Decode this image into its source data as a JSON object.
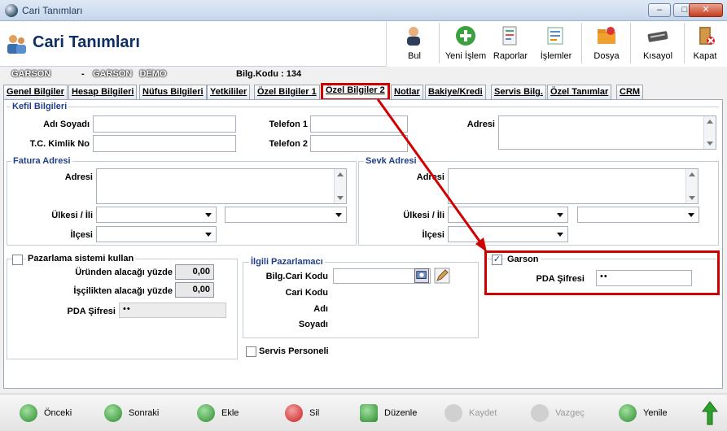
{
  "window": {
    "title": "Cari Tanımları"
  },
  "header": {
    "title": "Cari Tanımları"
  },
  "toolbar": {
    "bul": "Bul",
    "yeni_islem": "Yeni İşlem",
    "raporlar": "Raporlar",
    "islemler": "İşlemler",
    "dosya": "Dosya",
    "kisayol": "Kısayol",
    "kapat": "Kapat"
  },
  "info": {
    "name1": "GARSON",
    "dash": "-",
    "name2": "GARSON   DEMO",
    "bilg_kodu": "Bilg.Kodu : 134"
  },
  "tabs": [
    "Genel Bilgiler",
    "Hesap Bilgileri",
    "Nüfus Bilgileri",
    "Yetkililer",
    "Özel Bilgiler 1",
    "Özel Bilgiler 2",
    "Notlar",
    "Bakiye/Kredi",
    "Servis Bilg.",
    "Özel Tanımlar",
    "CRM"
  ],
  "kefil": {
    "title": "Kefil Bilgileri",
    "adi_soyadi": "Adı Soyadı",
    "tc": "T.C. Kimlik No",
    "telefon1": "Telefon 1",
    "telefon2": "Telefon 2",
    "adresi": "Adresi"
  },
  "fatura": {
    "title": "Fatura Adresi",
    "adresi": "Adresi",
    "ulkesi_ili": "Ülkesi / İli",
    "ilcesi": "İlçesi"
  },
  "sevk": {
    "title": "Sevk Adresi",
    "adresi": "Adresi",
    "ulkesi_ili": "Ülkesi / İli",
    "ilcesi": "İlçesi"
  },
  "pazarlama": {
    "checkbox": "Pazarlama sistemi kullan",
    "urunden": "Üründen alacağı yüzde",
    "urunden_val": "0,00",
    "iscilik": "İşçilikten alacağı yüzde",
    "iscilik_val": "0,00",
    "pda": "PDA Şifresi",
    "pda_val": "••"
  },
  "ilgili": {
    "title": "İlgili Pazarlamacı",
    "bilg_cari_kodu": "Bilg.Cari Kodu",
    "cari_kodu": "Cari Kodu",
    "adi": "Adı",
    "soyadi": "Soyadı",
    "servis": "Servis Personeli"
  },
  "garson": {
    "checkbox": "Garson",
    "checked": "✓",
    "pda": "PDA Şifresi",
    "pda_val": "••"
  },
  "bottom": {
    "onceki": "Önceki",
    "sonraki": "Sonraki",
    "ekle": "Ekle",
    "sil": "Sil",
    "duzenle": "Düzenle",
    "kaydet": "Kaydet",
    "vazgec": "Vazgeç",
    "yenile": "Yenile"
  },
  "colors": {
    "highlight": "#d00000",
    "title_blue": "#0f2f63",
    "group_title": "#1f3f8a"
  }
}
